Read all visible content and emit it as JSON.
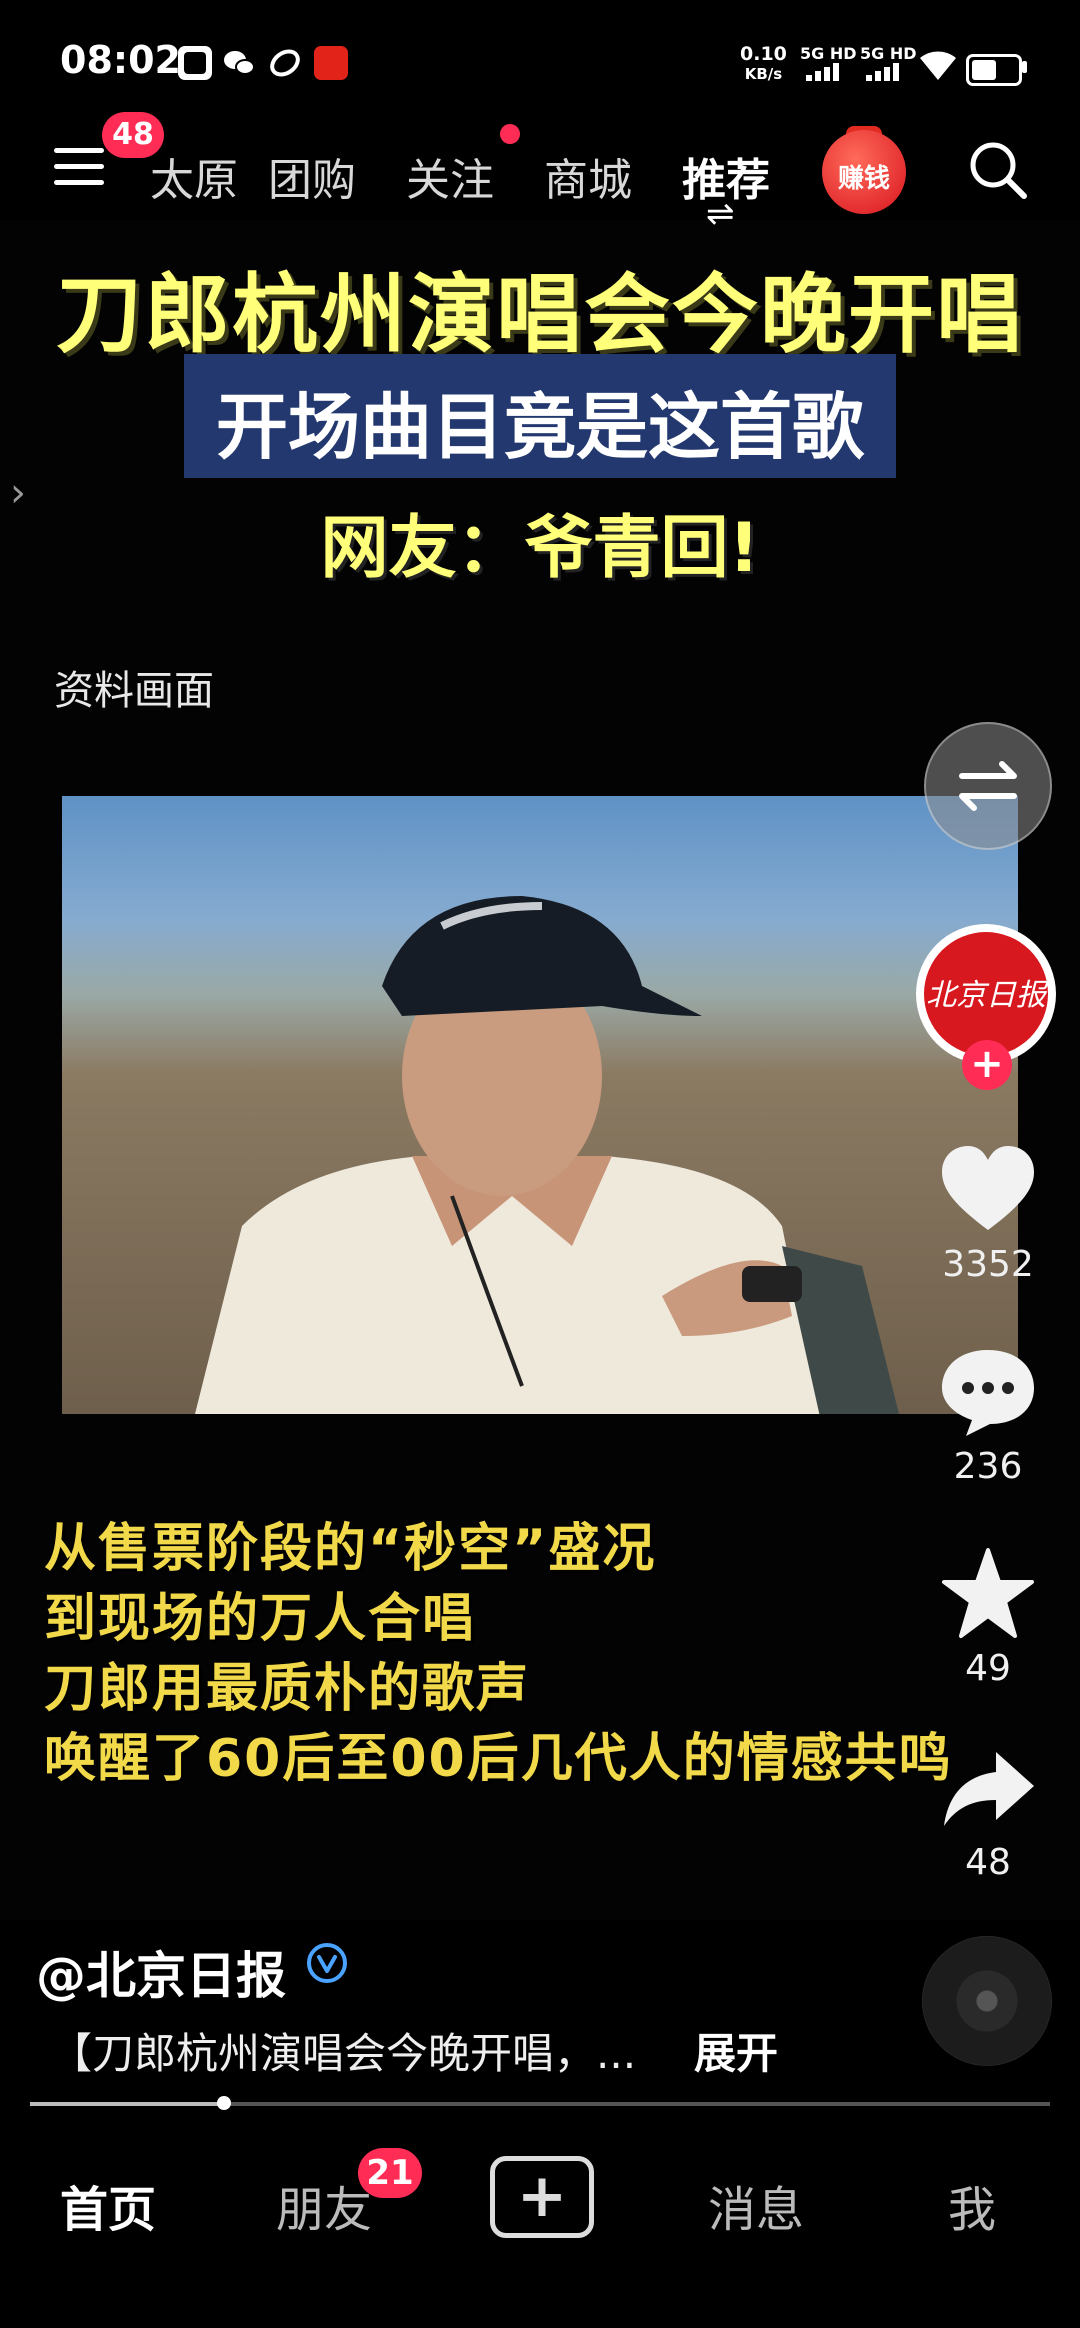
{
  "status_bar": {
    "time": "08:02",
    "net_speed_value": "0.10",
    "net_speed_unit": "KB/s",
    "sim1_label": "5G HD",
    "sim2_label": "5G HD",
    "battery_level": 0.55,
    "icons": [
      "kuaishou-app-icon",
      "wechat-icon",
      "link-icon",
      "red-app-icon"
    ]
  },
  "top_nav": {
    "menu_badge": "48",
    "tabs": [
      "太原",
      "团购",
      "关注",
      "商城",
      "推荐"
    ],
    "active_tab": "推荐",
    "earn_label": "赚钱"
  },
  "video": {
    "title_main": "刀郎杭州演唱会今晚开唱",
    "title_sub": "开场曲目竟是这首歌",
    "title_quote": "网友：爷青回!",
    "archive_label": "资料画面",
    "captions": [
      "从售票阶段的“秒空”盛况",
      "到现场的万人合唱",
      "刀郎用最质朴的歌声",
      "唤醒了60后至00后几代人的情感共鸣"
    ]
  },
  "rail": {
    "avatar_text": "北京日报",
    "likes": "3352",
    "comments": "236",
    "favorites": "49",
    "shares": "48"
  },
  "post": {
    "author": "@北京日报",
    "description": "【刀郎杭州演唱会今晚开唱，...",
    "expand_label": "展开",
    "progress": 0.19
  },
  "bottom_nav": {
    "home": "首页",
    "friends": "朋友",
    "friends_badge": "21",
    "create": "+",
    "messages": "消息",
    "me": "我"
  },
  "colors": {
    "accent_red": "#ff2d55",
    "title_yellow": "#ffff7a",
    "caption_yellow": "#f2d94a",
    "subtitle_bg": "#22386f"
  }
}
